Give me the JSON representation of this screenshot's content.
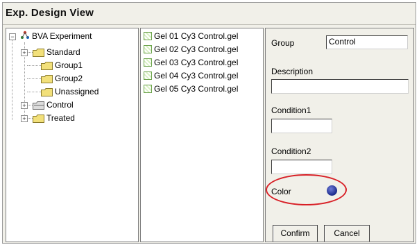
{
  "window": {
    "title": "Exp. Design View"
  },
  "tree": {
    "root": {
      "label": "BVA Experiment",
      "expander": "−"
    },
    "items": [
      {
        "label": "Standard",
        "expander": "+"
      },
      {
        "label": "Group1",
        "expander": ""
      },
      {
        "label": "Group2",
        "expander": ""
      },
      {
        "label": "Unassigned",
        "expander": ""
      },
      {
        "label": "Control",
        "expander": "+"
      },
      {
        "label": "Treated",
        "expander": "+"
      }
    ]
  },
  "gels": [
    "Gel 01 Cy3 Control.gel",
    "Gel 02 Cy3 Control.gel",
    "Gel 03 Cy3 Control.gel",
    "Gel 04 Cy3 Control.gel",
    "Gel 05 Cy3 Control.gel"
  ],
  "properties": {
    "group_label": "Group",
    "group_value": "Control",
    "description_label": "Description",
    "description_value": "",
    "condition1_label": "Condition1",
    "condition1_value": "",
    "condition2_label": "Condition2",
    "condition2_value": "",
    "color_label": "Color",
    "color_value": "#2a3aa8",
    "confirm_label": "Confirm",
    "cancel_label": "Cancel"
  },
  "colors": {
    "highlight_ellipse": "#d81f26",
    "folder": "#f2e07a",
    "folder_open": "#dcdcdc"
  },
  "icons": {
    "root": "network-tree-icon",
    "folder": "folder-icon",
    "gel": "gel-file-icon",
    "color": "color-swatch-icon"
  }
}
